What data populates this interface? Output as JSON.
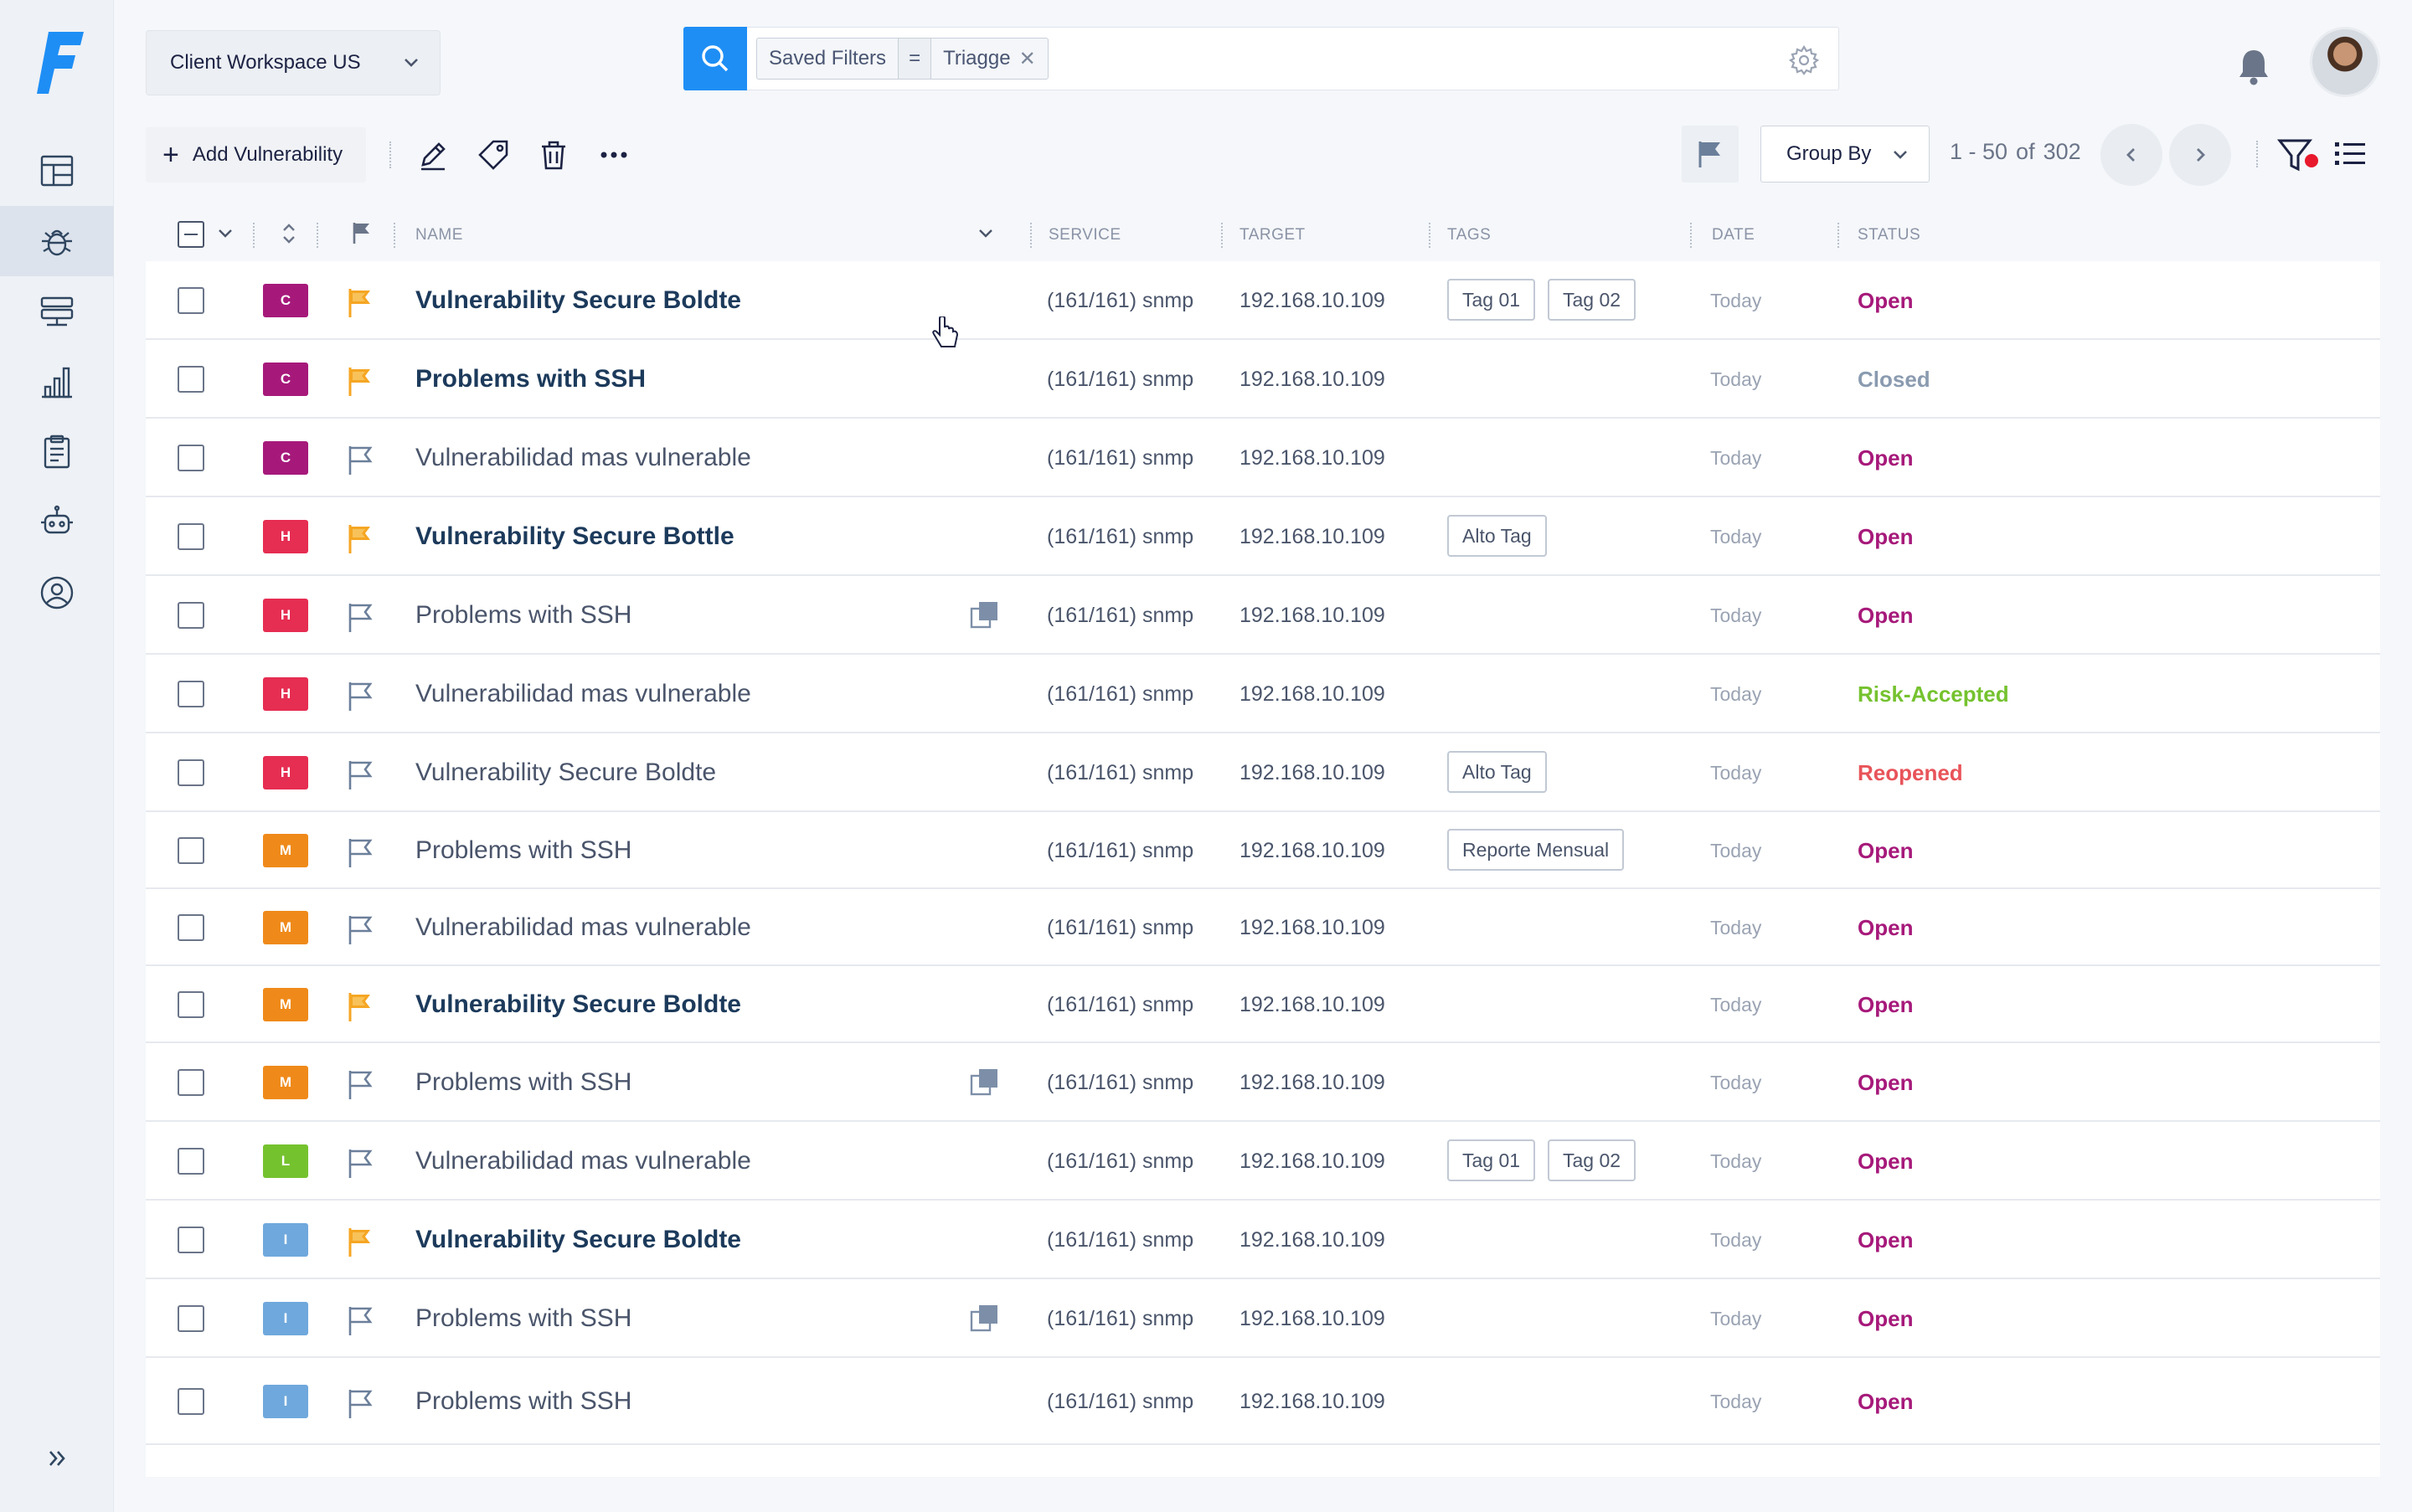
{
  "workspace": {
    "label": "Client  Workspace US"
  },
  "search": {
    "chip_key": "Saved Filters",
    "chip_op": "=",
    "chip_value": "Triagge",
    "chip_remove": "✕"
  },
  "toolbar": {
    "add_label": "Add Vulnerability"
  },
  "controls": {
    "group_by": "Group By",
    "pager_range": "1 - 50",
    "pager_of": "of",
    "pager_total": "302"
  },
  "columns": {
    "name": "NAME",
    "service": "SERVICE",
    "target": "TARGET",
    "tags": "TAGS",
    "date": "DATE",
    "status": "STATUS"
  },
  "colors": {
    "accent": "#1e8ef5",
    "critical": "#a6197a",
    "high": "#e62d52",
    "medium": "#ef8a1a",
    "low": "#75c22f",
    "info": "#6fa8dc",
    "flag_orange": "#f5a623"
  },
  "rows": [
    {
      "sev": "C",
      "flagged": true,
      "name": "Vulnerability Secure Boldte",
      "bold": true,
      "dup": false,
      "service": "(161/161) snmp",
      "target": "192.168.10.109",
      "tags": [
        "Tag 01",
        "Tag 02"
      ],
      "date": "Today",
      "status": "Open",
      "status_kind": "open"
    },
    {
      "sev": "C",
      "flagged": true,
      "name": "Problems with SSH",
      "bold": true,
      "dup": false,
      "service": "(161/161) snmp",
      "target": "192.168.10.109",
      "tags": [],
      "date": "Today",
      "status": "Closed",
      "status_kind": "closed"
    },
    {
      "sev": "C",
      "flagged": false,
      "name": "Vulnerabilidad mas vulnerable",
      "bold": false,
      "dup": false,
      "service": "(161/161) snmp",
      "target": "192.168.10.109",
      "tags": [],
      "date": "Today",
      "status": "Open",
      "status_kind": "open"
    },
    {
      "sev": "H",
      "flagged": true,
      "name": "Vulnerability Secure Bottle",
      "bold": true,
      "dup": false,
      "service": "(161/161) snmp",
      "target": "192.168.10.109",
      "tags": [
        "Alto Tag"
      ],
      "date": "Today",
      "status": "Open",
      "status_kind": "open"
    },
    {
      "sev": "H",
      "flagged": false,
      "name": "Problems with SSH",
      "bold": false,
      "dup": true,
      "service": "(161/161) snmp",
      "target": "192.168.10.109",
      "tags": [],
      "date": "Today",
      "status": "Open",
      "status_kind": "open"
    },
    {
      "sev": "H",
      "flagged": false,
      "name": "Vulnerabilidad mas vulnerable",
      "bold": false,
      "dup": false,
      "service": "(161/161) snmp",
      "target": "192.168.10.109",
      "tags": [],
      "date": "Today",
      "status": "Risk-Accepted",
      "status_kind": "risk"
    },
    {
      "sev": "H",
      "flagged": false,
      "name": "Vulnerability Secure Boldte",
      "bold": false,
      "dup": false,
      "service": "(161/161) snmp",
      "target": "192.168.10.109",
      "tags": [
        "Alto Tag"
      ],
      "date": "Today",
      "status": "Reopened",
      "status_kind": "reopen"
    },
    {
      "sev": "M",
      "flagged": false,
      "name": "Problems with SSH",
      "bold": false,
      "dup": false,
      "service": "(161/161) snmp",
      "target": "192.168.10.109",
      "tags": [
        "Reporte Mensual"
      ],
      "date": "Today",
      "status": "Open",
      "status_kind": "open"
    },
    {
      "sev": "M",
      "flagged": false,
      "name": "Vulnerabilidad mas vulnerable",
      "bold": false,
      "dup": false,
      "service": "(161/161) snmp",
      "target": "192.168.10.109",
      "tags": [],
      "date": "Today",
      "status": "Open",
      "status_kind": "open"
    },
    {
      "sev": "M",
      "flagged": true,
      "name": "Vulnerability Secure Boldte",
      "bold": true,
      "dup": false,
      "service": "(161/161) snmp",
      "target": "192.168.10.109",
      "tags": [],
      "date": "Today",
      "status": "Open",
      "status_kind": "open"
    },
    {
      "sev": "M",
      "flagged": false,
      "name": "Problems with SSH",
      "bold": false,
      "dup": true,
      "service": "(161/161) snmp",
      "target": "192.168.10.109",
      "tags": [],
      "date": "Today",
      "status": "Open",
      "status_kind": "open"
    },
    {
      "sev": "L",
      "flagged": false,
      "name": "Vulnerabilidad mas vulnerable",
      "bold": false,
      "dup": false,
      "service": "(161/161) snmp",
      "target": "192.168.10.109",
      "tags": [
        "Tag 01",
        "Tag 02"
      ],
      "date": "Today",
      "status": "Open",
      "status_kind": "open"
    },
    {
      "sev": "I",
      "flagged": true,
      "name": "Vulnerability Secure Boldte",
      "bold": true,
      "dup": false,
      "service": "(161/161) snmp",
      "target": "192.168.10.109",
      "tags": [],
      "date": "Today",
      "status": "Open",
      "status_kind": "open"
    },
    {
      "sev": "I",
      "flagged": false,
      "name": "Problems with SSH",
      "bold": false,
      "dup": true,
      "service": "(161/161) snmp",
      "target": "192.168.10.109",
      "tags": [],
      "date": "Today",
      "status": "Open",
      "status_kind": "open"
    },
    {
      "sev": "I",
      "flagged": false,
      "name": "Problems with SSH",
      "bold": false,
      "dup": false,
      "service": "(161/161) snmp",
      "target": "192.168.10.109",
      "tags": [],
      "date": "Today",
      "status": "Open",
      "status_kind": "open"
    }
  ]
}
